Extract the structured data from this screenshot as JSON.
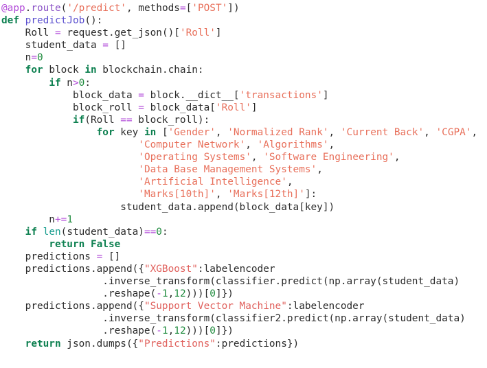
{
  "editor": {
    "language": "python",
    "background": "#ffffff",
    "font_size_px": 14,
    "colors": {
      "plain": "#2b2b2b",
      "keyword": "#0d8050",
      "builtin": "#1a9e8f",
      "function": "#5a4fcf",
      "decorator": "#b14ad8",
      "string": "#e8705b",
      "number": "#1d8a3c",
      "operator": "#b14ad8"
    }
  },
  "code": {
    "lines": [
      {
        "n": 1,
        "tokens": [
          {
            "t": "@app",
            "c": "decorator"
          },
          {
            "t": ".",
            "c": "plain"
          },
          {
            "t": "route",
            "c": "deco-attr"
          },
          {
            "t": "(",
            "c": "punct"
          },
          {
            "t": "'/predict'",
            "c": "str"
          },
          {
            "t": ", methods",
            "c": "plain"
          },
          {
            "t": "=",
            "c": "op"
          },
          {
            "t": "[",
            "c": "punct"
          },
          {
            "t": "'POST'",
            "c": "str"
          },
          {
            "t": "])",
            "c": "punct"
          }
        ]
      },
      {
        "n": 2,
        "tokens": [
          {
            "t": "def",
            "c": "kw"
          },
          {
            "t": " ",
            "c": "plain"
          },
          {
            "t": "predictJob",
            "c": "func"
          },
          {
            "t": "():",
            "c": "punct"
          }
        ]
      },
      {
        "n": 3,
        "tokens": [
          {
            "t": "    Roll ",
            "c": "plain"
          },
          {
            "t": "=",
            "c": "op"
          },
          {
            "t": " request.get_json()[",
            "c": "plain"
          },
          {
            "t": "'Roll'",
            "c": "str"
          },
          {
            "t": "]",
            "c": "punct"
          }
        ]
      },
      {
        "n": 4,
        "tokens": [
          {
            "t": "    student_data ",
            "c": "plain"
          },
          {
            "t": "=",
            "c": "op"
          },
          {
            "t": " []",
            "c": "plain"
          }
        ]
      },
      {
        "n": 5,
        "tokens": [
          {
            "t": "    n",
            "c": "plain"
          },
          {
            "t": "=",
            "c": "op"
          },
          {
            "t": "0",
            "c": "num"
          }
        ]
      },
      {
        "n": 6,
        "tokens": [
          {
            "t": "    ",
            "c": "plain"
          },
          {
            "t": "for",
            "c": "kw"
          },
          {
            "t": " block ",
            "c": "plain"
          },
          {
            "t": "in",
            "c": "kw"
          },
          {
            "t": " blockchain.chain:",
            "c": "plain"
          }
        ]
      },
      {
        "n": 7,
        "tokens": [
          {
            "t": "        ",
            "c": "plain"
          },
          {
            "t": "if",
            "c": "kw"
          },
          {
            "t": " n",
            "c": "plain"
          },
          {
            "t": ">",
            "c": "op"
          },
          {
            "t": "0",
            "c": "num"
          },
          {
            "t": ":",
            "c": "plain"
          }
        ]
      },
      {
        "n": 8,
        "tokens": [
          {
            "t": "            block_data ",
            "c": "plain"
          },
          {
            "t": "=",
            "c": "op"
          },
          {
            "t": " block.__dict__[",
            "c": "plain"
          },
          {
            "t": "'transactions'",
            "c": "str"
          },
          {
            "t": "]",
            "c": "punct"
          }
        ]
      },
      {
        "n": 9,
        "tokens": [
          {
            "t": "            block_roll ",
            "c": "plain"
          },
          {
            "t": "=",
            "c": "op"
          },
          {
            "t": " block_data[",
            "c": "plain"
          },
          {
            "t": "'Roll'",
            "c": "str"
          },
          {
            "t": "]",
            "c": "punct"
          }
        ]
      },
      {
        "n": 10,
        "tokens": [
          {
            "t": "            ",
            "c": "plain"
          },
          {
            "t": "if",
            "c": "kw"
          },
          {
            "t": "(Roll ",
            "c": "plain"
          },
          {
            "t": "==",
            "c": "op"
          },
          {
            "t": " block_roll):",
            "c": "plain"
          }
        ]
      },
      {
        "n": 11,
        "tokens": [
          {
            "t": "                ",
            "c": "plain"
          },
          {
            "t": "for",
            "c": "kw"
          },
          {
            "t": " key ",
            "c": "plain"
          },
          {
            "t": "in",
            "c": "kw"
          },
          {
            "t": " [",
            "c": "punct"
          },
          {
            "t": "'Gender'",
            "c": "str"
          },
          {
            "t": ", ",
            "c": "plain"
          },
          {
            "t": "'Normalized Rank'",
            "c": "str"
          },
          {
            "t": ", ",
            "c": "plain"
          },
          {
            "t": "'Current Back'",
            "c": "str"
          },
          {
            "t": ", ",
            "c": "plain"
          },
          {
            "t": "'CGPA'",
            "c": "str"
          },
          {
            "t": ",",
            "c": "plain"
          }
        ]
      },
      {
        "n": 12,
        "tokens": [
          {
            "t": "                       ",
            "c": "plain"
          },
          {
            "t": "'Computer Network'",
            "c": "str"
          },
          {
            "t": ", ",
            "c": "plain"
          },
          {
            "t": "'Algorithms'",
            "c": "str"
          },
          {
            "t": ",",
            "c": "plain"
          }
        ]
      },
      {
        "n": 13,
        "tokens": [
          {
            "t": "                       ",
            "c": "plain"
          },
          {
            "t": "'Operating Systems'",
            "c": "str"
          },
          {
            "t": ", ",
            "c": "plain"
          },
          {
            "t": "'Software Engineering'",
            "c": "str"
          },
          {
            "t": ",",
            "c": "plain"
          }
        ]
      },
      {
        "n": 14,
        "tokens": [
          {
            "t": "                       ",
            "c": "plain"
          },
          {
            "t": "'Data Base Management Systems'",
            "c": "str"
          },
          {
            "t": ",",
            "c": "plain"
          }
        ]
      },
      {
        "n": 15,
        "tokens": [
          {
            "t": "                       ",
            "c": "plain"
          },
          {
            "t": "'Artificial Intelligence'",
            "c": "str"
          },
          {
            "t": ",",
            "c": "plain"
          }
        ]
      },
      {
        "n": 16,
        "tokens": [
          {
            "t": "                       ",
            "c": "plain"
          },
          {
            "t": "'Marks[10th]'",
            "c": "str"
          },
          {
            "t": ", ",
            "c": "plain"
          },
          {
            "t": "'Marks[12th]'",
            "c": "str"
          },
          {
            "t": "]:",
            "c": "punct"
          }
        ]
      },
      {
        "n": 17,
        "tokens": [
          {
            "t": "                    student_data.append(block_data[key])",
            "c": "plain"
          }
        ]
      },
      {
        "n": 18,
        "tokens": [
          {
            "t": "        n",
            "c": "plain"
          },
          {
            "t": "+=",
            "c": "op"
          },
          {
            "t": "1",
            "c": "num"
          }
        ]
      },
      {
        "n": 19,
        "tokens": [
          {
            "t": "    ",
            "c": "plain"
          },
          {
            "t": "if",
            "c": "kw"
          },
          {
            "t": " ",
            "c": "plain"
          },
          {
            "t": "len",
            "c": "builtin"
          },
          {
            "t": "(student_data)",
            "c": "plain"
          },
          {
            "t": "==",
            "c": "op"
          },
          {
            "t": "0",
            "c": "num"
          },
          {
            "t": ":",
            "c": "plain"
          }
        ]
      },
      {
        "n": 20,
        "tokens": [
          {
            "t": "        ",
            "c": "plain"
          },
          {
            "t": "return",
            "c": "kw"
          },
          {
            "t": " ",
            "c": "plain"
          },
          {
            "t": "False",
            "c": "kw2"
          }
        ]
      },
      {
        "n": 21,
        "tokens": [
          {
            "t": "    predictions ",
            "c": "plain"
          },
          {
            "t": "=",
            "c": "op"
          },
          {
            "t": " []",
            "c": "plain"
          }
        ]
      },
      {
        "n": 22,
        "tokens": [
          {
            "t": "    predictions.append({",
            "c": "plain"
          },
          {
            "t": "\"XGBoost\"",
            "c": "str2"
          },
          {
            "t": ":labelencoder",
            "c": "plain"
          }
        ]
      },
      {
        "n": 23,
        "tokens": [
          {
            "t": "                 .inverse_transform(classifier.predict(np.array(student_data)",
            "c": "plain"
          }
        ]
      },
      {
        "n": 24,
        "tokens": [
          {
            "t": "                 .reshape(",
            "c": "plain"
          },
          {
            "t": "-",
            "c": "op"
          },
          {
            "t": "1",
            "c": "num"
          },
          {
            "t": ",",
            "c": "plain"
          },
          {
            "t": "12",
            "c": "num"
          },
          {
            "t": ")))[",
            "c": "plain"
          },
          {
            "t": "0",
            "c": "num"
          },
          {
            "t": "]})",
            "c": "plain"
          }
        ]
      },
      {
        "n": 25,
        "tokens": [
          {
            "t": "    predictions.append({",
            "c": "plain"
          },
          {
            "t": "\"Support Vector Machine\"",
            "c": "str2"
          },
          {
            "t": ":labelencoder",
            "c": "plain"
          }
        ]
      },
      {
        "n": 26,
        "tokens": [
          {
            "t": "                 .inverse_transform(classifier2.predict(np.array(student_data)",
            "c": "plain"
          }
        ]
      },
      {
        "n": 27,
        "tokens": [
          {
            "t": "                 .reshape(",
            "c": "plain"
          },
          {
            "t": "-",
            "c": "op"
          },
          {
            "t": "1",
            "c": "num"
          },
          {
            "t": ",",
            "c": "plain"
          },
          {
            "t": "12",
            "c": "num"
          },
          {
            "t": ")))[",
            "c": "plain"
          },
          {
            "t": "0",
            "c": "num"
          },
          {
            "t": "]})",
            "c": "plain"
          }
        ]
      },
      {
        "n": 28,
        "tokens": [
          {
            "t": "    ",
            "c": "plain"
          },
          {
            "t": "return",
            "c": "kw"
          },
          {
            "t": " json.dumps({",
            "c": "plain"
          },
          {
            "t": "\"Predictions\"",
            "c": "str2"
          },
          {
            "t": ":predictions})",
            "c": "plain"
          }
        ]
      }
    ],
    "plain_text": "@app.route('/predict', methods=['POST'])\ndef predictJob():\n    Roll = request.get_json()['Roll']\n    student_data = []\n    n=0\n    for block in blockchain.chain:\n        if n>0:\n            block_data = block.__dict__['transactions']\n            block_roll = block_data['Roll']\n            if(Roll == block_roll):\n                for key in ['Gender', 'Normalized Rank', 'Current Back', 'CGPA',\n                       'Computer Network', 'Algorithms',\n                       'Operating Systems', 'Software Engineering',\n                       'Data Base Management Systems',\n                       'Artificial Intelligence',\n                       'Marks[10th]', 'Marks[12th]']:\n                    student_data.append(block_data[key])\n        n+=1\n    if len(student_data)==0:\n        return False\n    predictions = []\n    predictions.append({\"XGBoost\":labelencoder\n                 .inverse_transform(classifier.predict(np.array(student_data)\n                 .reshape(-1,12)))[0]})\n    predictions.append({\"Support Vector Machine\":labelencoder\n                 .inverse_transform(classifier2.predict(np.array(student_data)\n                 .reshape(-1,12)))[0]})\n    return json.dumps({\"Predictions\":predictions})"
  }
}
